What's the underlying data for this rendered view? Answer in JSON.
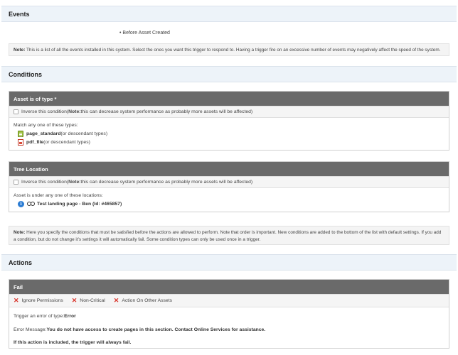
{
  "events": {
    "header": "Events",
    "bullet_item": "Before Asset Created",
    "note_label": "Note:",
    "note_text": " This is a list of all the events installed in this system. Select the ones you want this trigger to respond to. Having a trigger fire on an excessive number of events may negatively affect the speed of the system."
  },
  "conditions": {
    "header": "Conditions",
    "asset_type": {
      "title": "Asset is of type *",
      "inverse_label": "Inverse this condition",
      "inverse_note_open": " (",
      "inverse_note_bold": "Note:",
      "inverse_note_rest": " this can decrease system performance as probably more assets will be affected)",
      "match_label": "Match any one of these types:",
      "types": [
        {
          "name": "page_standard",
          "suffix": " (or descendant types)",
          "icon": "page-standard-icon"
        },
        {
          "name": "pdf_file",
          "suffix": " (or descendant types)",
          "icon": "pdf-file-icon"
        }
      ]
    },
    "tree_location": {
      "title": "Tree Location",
      "inverse_label": "Inverse this condition",
      "inverse_note_open": " (",
      "inverse_note_bold": "Note:",
      "inverse_note_rest": " this can decrease system performance as probably more assets will be affected)",
      "under_label": "Asset is under any one of these locations:",
      "location": "Test landing page - Ben (Id: #465857)"
    },
    "note_label": "Note:",
    "note_text": " Here you specify the conditions that must be satisfied before the actions are allowed to perform. Note that order is important. New conditions are added to the bottom of the list with default settings. If you add a condition, but do not change it's settings it will automatically fail. Some condition types can only be used once in a trigger."
  },
  "actions": {
    "header": "Actions",
    "fail": {
      "title": "Fail",
      "options": [
        "Ignore Permissions",
        "Non-Critical",
        "Action On Other Assets"
      ],
      "error_type_label": "Trigger an error of type:",
      "error_type_value": "Error",
      "error_msg_label": "Error Message:",
      "error_msg_value": "You do not have access to create pages in this section. Contact Online Services for assistance.",
      "always_fail": "If this action is included, the trigger will always fail."
    }
  }
}
